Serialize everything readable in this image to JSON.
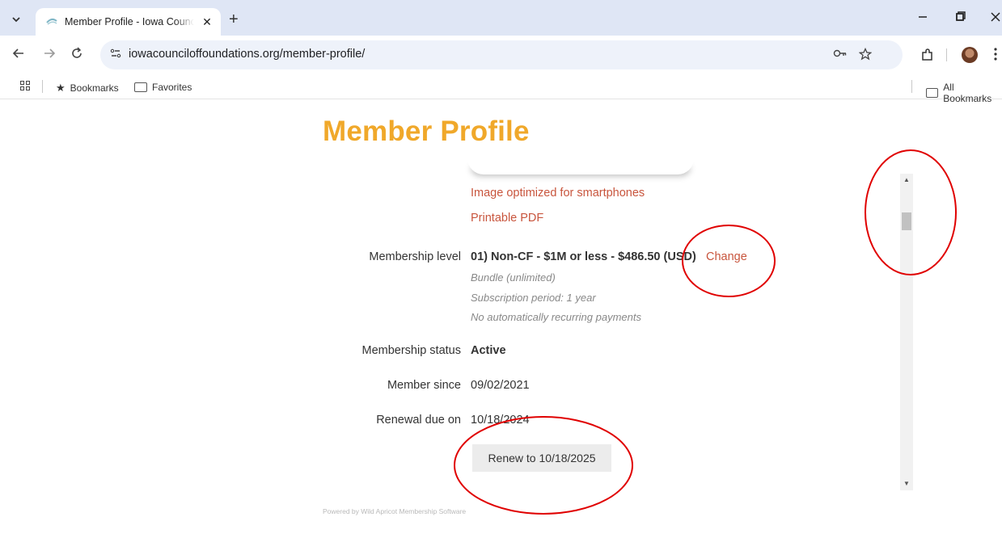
{
  "browser": {
    "tab_title": "Member Profile - Iowa Council of Foundations",
    "tab_close": "✕",
    "new_tab": "+",
    "url": "iowacounciloffoundations.org/member-profile/",
    "bookmarks": {
      "bookmarks_label": "Bookmarks",
      "favorites_label": "Favorites",
      "all_bookmarks_label": "All Bookmarks"
    }
  },
  "page": {
    "title": "Member Profile",
    "links": {
      "smartphone": "Image optimized for smartphones",
      "pdf": "Printable PDF"
    },
    "membership_level": {
      "label": "Membership level",
      "value": "01) Non-CF - $1M or less - $486.50 (USD)",
      "change_link": "Change",
      "notes": [
        "Bundle (unlimited)",
        "Subscription period: 1 year",
        "No automatically recurring payments"
      ]
    },
    "membership_status": {
      "label": "Membership status",
      "value": "Active"
    },
    "member_since": {
      "label": "Member since",
      "value": "09/02/2021"
    },
    "renewal_due": {
      "label": "Renewal due on",
      "value": "10/18/2024"
    },
    "renew_button": "Renew to 10/18/2025",
    "footer": "Powered by Wild Apricot Membership Software"
  },
  "colors": {
    "title_orange": "#f0a82a",
    "link_red": "#c8553d",
    "annotation_red": "#e00000"
  }
}
